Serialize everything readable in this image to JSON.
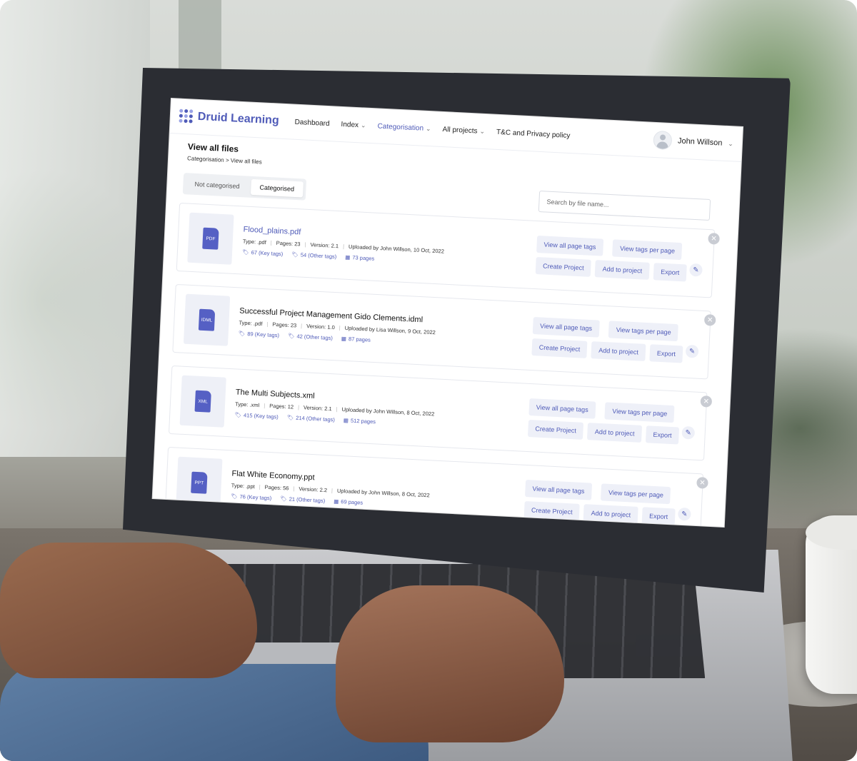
{
  "app": {
    "brand": "Druid Learning",
    "nav": [
      {
        "label": "Dashboard",
        "has_menu": false,
        "active": false
      },
      {
        "label": "Index",
        "has_menu": true,
        "active": false
      },
      {
        "label": "Categorisation",
        "has_menu": true,
        "active": true
      },
      {
        "label": "All projects",
        "has_menu": true,
        "active": false
      },
      {
        "label": "T&C and Privacy policy",
        "has_menu": false,
        "active": false
      }
    ],
    "user": "John Willson",
    "accent": "#4f5bb8"
  },
  "page": {
    "title": "View all files",
    "breadcrumb": "Categorisation > View all files"
  },
  "filter": {
    "options": [
      "Not categorised",
      "Categorised"
    ],
    "selected": "Categorised"
  },
  "search": {
    "placeholder": "Search by file name..."
  },
  "actions": {
    "view_all": "View all page tags",
    "view_per_page": "View tags per page",
    "create": "Create Project",
    "add": "Add to project",
    "export": "Export"
  },
  "files": [
    {
      "name": "Flood_plains.pdf",
      "icon": "PDF",
      "highlight": true,
      "type": "Type: .pdf",
      "pages": "Pages: 23",
      "version": "Version: 2.1",
      "uploaded": "Uploaded by John Willson, 10 Oct, 2022",
      "key_tags": "67 (Key tags)",
      "other_tags": "54 (Other tags)",
      "page_count": "73 pages"
    },
    {
      "name": "Successful Project Management Gido Clements.idml",
      "icon": "IDML",
      "highlight": false,
      "type": "Type: .pdf",
      "pages": "Pages: 23",
      "version": "Version: 1.0",
      "uploaded": "Uploaded by Lisa Willson, 9 Oct, 2022",
      "key_tags": "89 (Key tags)",
      "other_tags": "42 (Other tags)",
      "page_count": "87 pages"
    },
    {
      "name": "The Multi Subjects.xml",
      "icon": "XML",
      "highlight": false,
      "type": "Type: .xml",
      "pages": "Pages: 12",
      "version": "Version: 2.1",
      "uploaded": "Uploaded by John Willson, 8 Oct, 2022",
      "key_tags": "415 (Key tags)",
      "other_tags": "214 (Other tags)",
      "page_count": "512 pages"
    },
    {
      "name": "Flat White Economy.ppt",
      "icon": "PPT",
      "highlight": false,
      "type": "Type: .ppt",
      "pages": "Pages: 56",
      "version": "Version: 2.2",
      "uploaded": "Uploaded by John Willson, 8 Oct, 2022",
      "key_tags": "76 (Key tags)",
      "other_tags": "21 (Other tags)",
      "page_count": "69 pages"
    }
  ]
}
